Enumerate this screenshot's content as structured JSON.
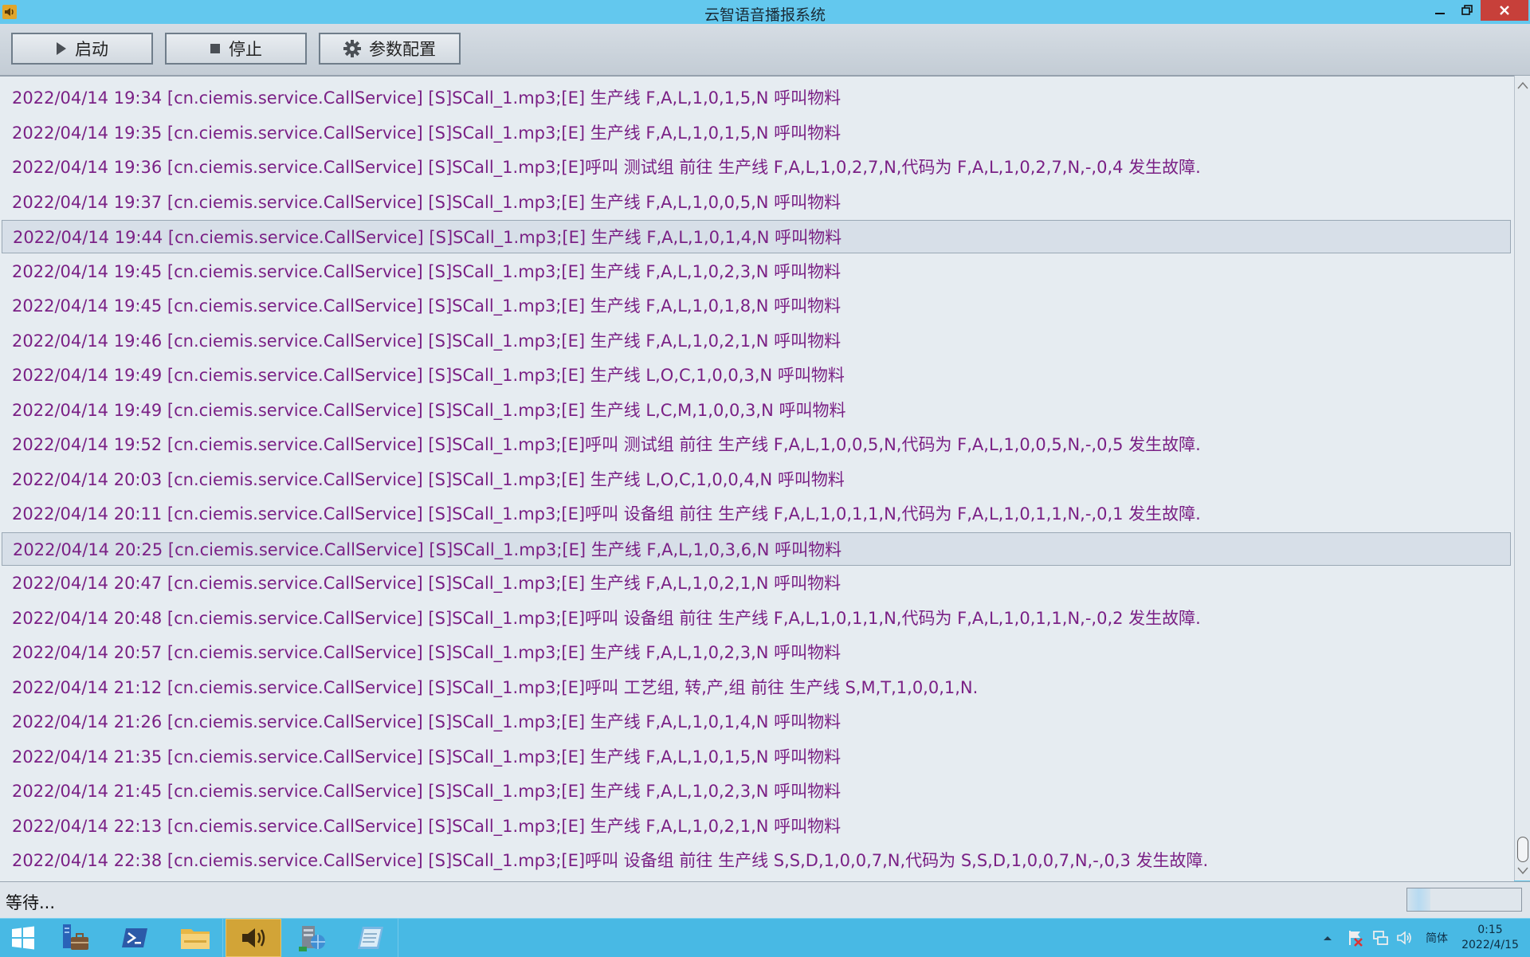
{
  "window": {
    "title": "云智语音播报系统"
  },
  "toolbar": {
    "start_label": "启动",
    "stop_label": "停止",
    "config_label": "参数配置"
  },
  "log": {
    "entries": [
      "2022/04/14 19:34 [cn.ciemis.service.CallService] [S]SCall_1.mp3;[E] 生产线 F,A,L,1,0,1,5,N 呼叫物料",
      "2022/04/14 19:35 [cn.ciemis.service.CallService] [S]SCall_1.mp3;[E] 生产线 F,A,L,1,0,1,5,N 呼叫物料",
      "2022/04/14 19:36 [cn.ciemis.service.CallService] [S]SCall_1.mp3;[E]呼叫 测试组 前往  生产线 F,A,L,1,0,2,7,N,代码为 F,A,L,1,0,2,7,N,-,0,4 发生故障.",
      "2022/04/14 19:37 [cn.ciemis.service.CallService] [S]SCall_1.mp3;[E] 生产线 F,A,L,1,0,0,5,N 呼叫物料",
      "2022/04/14 19:44 [cn.ciemis.service.CallService] [S]SCall_1.mp3;[E] 生产线 F,A,L,1,0,1,4,N 呼叫物料",
      "2022/04/14 19:45 [cn.ciemis.service.CallService] [S]SCall_1.mp3;[E] 生产线 F,A,L,1,0,2,3,N 呼叫物料",
      "2022/04/14 19:45 [cn.ciemis.service.CallService] [S]SCall_1.mp3;[E] 生产线 F,A,L,1,0,1,8,N 呼叫物料",
      "2022/04/14 19:46 [cn.ciemis.service.CallService] [S]SCall_1.mp3;[E] 生产线 F,A,L,1,0,2,1,N 呼叫物料",
      "2022/04/14 19:49 [cn.ciemis.service.CallService] [S]SCall_1.mp3;[E] 生产线 L,O,C,1,0,0,3,N 呼叫物料",
      "2022/04/14 19:49 [cn.ciemis.service.CallService] [S]SCall_1.mp3;[E] 生产线 L,C,M,1,0,0,3,N 呼叫物料",
      "2022/04/14 19:52 [cn.ciemis.service.CallService] [S]SCall_1.mp3;[E]呼叫 测试组 前往  生产线 F,A,L,1,0,0,5,N,代码为 F,A,L,1,0,0,5,N,-,0,5 发生故障.",
      "2022/04/14 20:03 [cn.ciemis.service.CallService] [S]SCall_1.mp3;[E] 生产线 L,O,C,1,0,0,4,N 呼叫物料",
      "2022/04/14 20:11 [cn.ciemis.service.CallService] [S]SCall_1.mp3;[E]呼叫 设备组 前往  生产线 F,A,L,1,0,1,1,N,代码为 F,A,L,1,0,1,1,N,-,0,1 发生故障.",
      "2022/04/14 20:25 [cn.ciemis.service.CallService] [S]SCall_1.mp3;[E] 生产线 F,A,L,1,0,3,6,N 呼叫物料",
      "2022/04/14 20:47 [cn.ciemis.service.CallService] [S]SCall_1.mp3;[E] 生产线 F,A,L,1,0,2,1,N 呼叫物料",
      "2022/04/14 20:48 [cn.ciemis.service.CallService] [S]SCall_1.mp3;[E]呼叫 设备组 前往  生产线 F,A,L,1,0,1,1,N,代码为 F,A,L,1,0,1,1,N,-,0,2 发生故障.",
      "2022/04/14 20:57 [cn.ciemis.service.CallService] [S]SCall_1.mp3;[E] 生产线 F,A,L,1,0,2,3,N 呼叫物料",
      "2022/04/14 21:12 [cn.ciemis.service.CallService] [S]SCall_1.mp3;[E]呼叫 工艺组, 转,产,组 前往 生产线 S,M,T,1,0,0,1,N.",
      "2022/04/14 21:26 [cn.ciemis.service.CallService] [S]SCall_1.mp3;[E] 生产线 F,A,L,1,0,1,4,N 呼叫物料",
      "2022/04/14 21:35 [cn.ciemis.service.CallService] [S]SCall_1.mp3;[E] 生产线 F,A,L,1,0,1,5,N 呼叫物料",
      "2022/04/14 21:45 [cn.ciemis.service.CallService] [S]SCall_1.mp3;[E] 生产线 F,A,L,1,0,2,3,N 呼叫物料",
      "2022/04/14 22:13 [cn.ciemis.service.CallService] [S]SCall_1.mp3;[E] 生产线 F,A,L,1,0,2,1,N 呼叫物料",
      "2022/04/14 22:38 [cn.ciemis.service.CallService] [S]SCall_1.mp3;[E]呼叫 设备组 前往  生产线 S,S,D,1,0,0,7,N,代码为 S,S,D,1,0,0,7,N,-,0,3 发生故障."
    ],
    "highlighted_rows": [
      4,
      13
    ]
  },
  "status": {
    "text": "等待...",
    "progress_fraction": 0.2
  },
  "taskbar": {
    "ime_label": "简体",
    "clock_time": "0:15",
    "clock_date": "2022/4/15"
  },
  "colors": {
    "log_text": "#7a2085",
    "titlebar": "#63c8ee",
    "taskbar": "#48b9e4",
    "active_task": "#d2a437",
    "close_button": "#c7403a"
  }
}
